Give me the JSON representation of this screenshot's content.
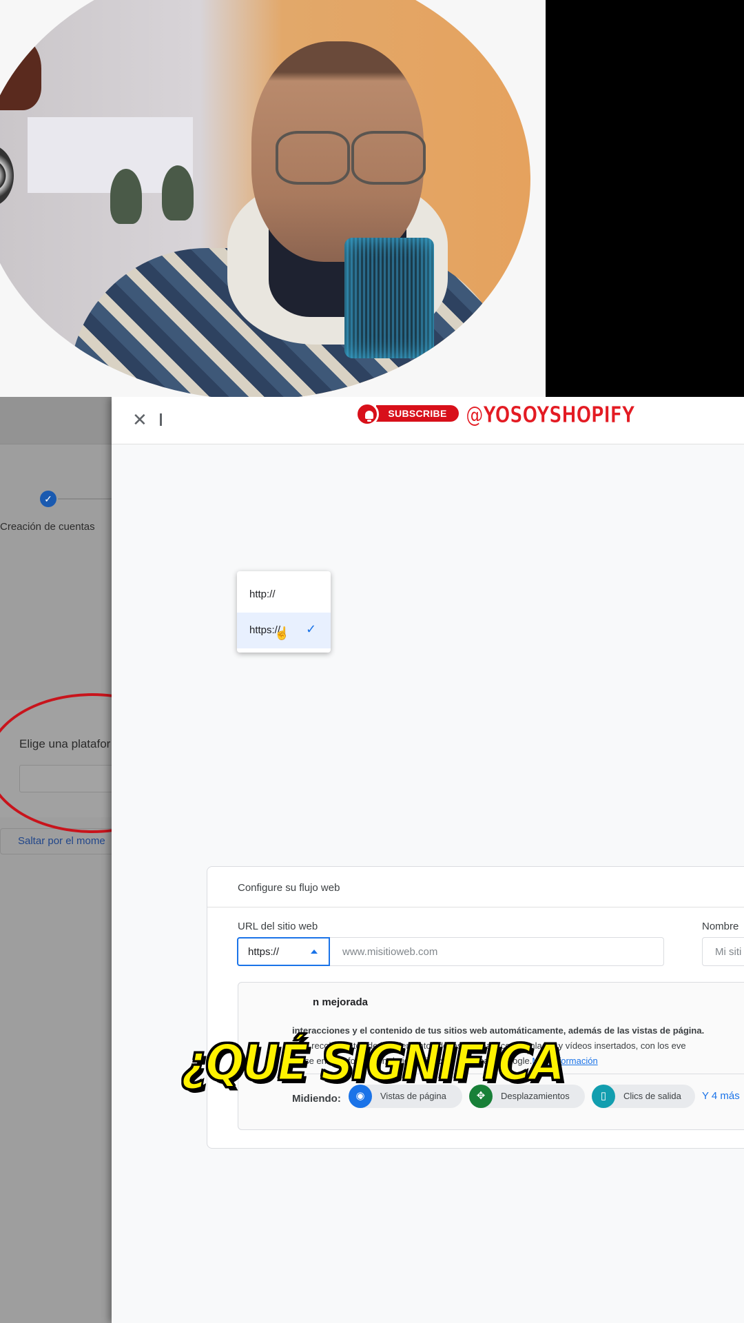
{
  "overlay": {
    "subscribe_label": "SUBSCRIBE",
    "channel_handle": "@YOSOYSHOPIFY",
    "caption": "¿QUÉ SIGNIFICA"
  },
  "left_panel": {
    "step_label": "Creación de cuentas",
    "platform_label": "Elige una platafor",
    "skip_label": "Saltar por el mome"
  },
  "dialog": {
    "card_title": "Configure su flujo web",
    "url_label": "URL del sitio web",
    "protocol_selected": "https://",
    "url_placeholder": "www.misitioweb.com",
    "name_label": "Nombre",
    "name_placeholder": "Mi siti",
    "measurement": {
      "title": "n mejorada",
      "desc_line_1": "interacciones y el contenido de tus sitios web automáticamente, además de las vistas de página.",
      "desc_line_2": "e se recojan datos de los elementos de las páginas, como enlaces y vídeos insertados, con los eve",
      "desc_line_3_prefix": "no se envíe información de identificación personal a Google.",
      "more_info_link": "Más información",
      "measuring_label": "Midiendo:",
      "chips": [
        {
          "label": "Vistas de página",
          "icon": "eye-icon",
          "color": "#1a73e8"
        },
        {
          "label": "Desplazamientos",
          "icon": "move-arrows-icon",
          "color": "#188038"
        },
        {
          "label": "Clics de salida",
          "icon": "mouse-icon",
          "color": "#129eaf"
        }
      ],
      "more_chips": "Y 4 más"
    },
    "dropdown": {
      "options": [
        "http://",
        "https://"
      ],
      "selected_index": 1
    }
  }
}
